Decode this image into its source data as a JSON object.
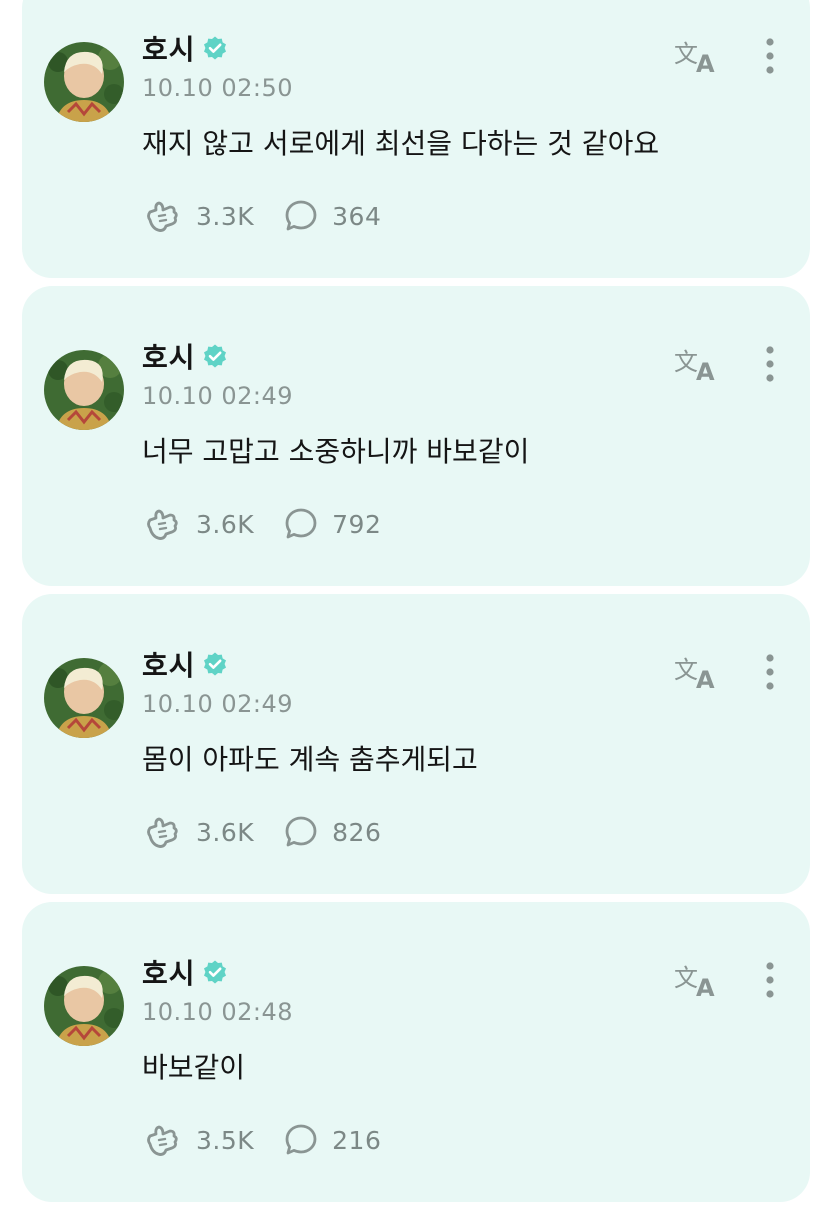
{
  "colors": {
    "card_background": "#e8f8f5",
    "verified_badge": "#5fd3c6",
    "icon_gray": "#8a9593"
  },
  "icons": {
    "verified": "verified-badge-icon",
    "translate": "translate-icon",
    "more": "more-vertical-icon",
    "like": "like-hand-icon",
    "comment": "comment-bubble-icon"
  },
  "posts": [
    {
      "author": "호시",
      "time": "10.10 02:50",
      "text": "재지 않고 서로에게 최선을 다하는 것 같아요",
      "likes": "3.3K",
      "comments": "364"
    },
    {
      "author": "호시",
      "time": "10.10 02:49",
      "text": "너무 고맙고 소중하니까 바보같이",
      "likes": "3.6K",
      "comments": "792"
    },
    {
      "author": "호시",
      "time": "10.10 02:49",
      "text": "몸이 아파도 계속 춤추게되고",
      "likes": "3.6K",
      "comments": "826"
    },
    {
      "author": "호시",
      "time": "10.10 02:48",
      "text": "바보같이",
      "likes": "3.5K",
      "comments": "216"
    }
  ]
}
